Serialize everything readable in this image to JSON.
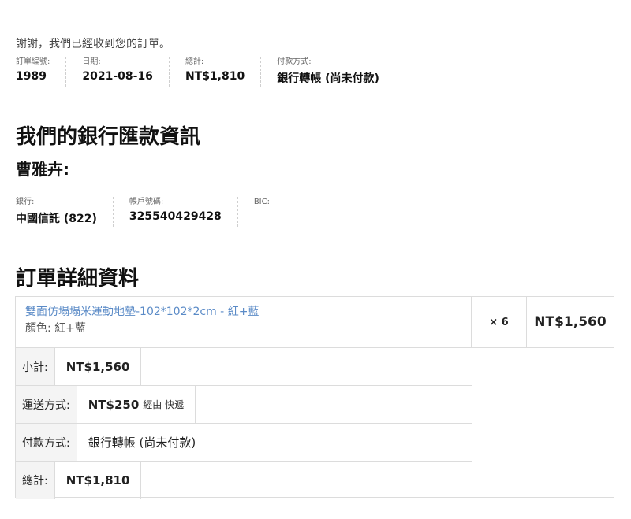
{
  "thanks": "謝謝，我們已經收到您的訂單。",
  "overview": [
    {
      "label": "訂單編號:",
      "value": "1989"
    },
    {
      "label": "日期:",
      "value": "2021-08-16"
    },
    {
      "label": "總計:",
      "value": "NT$1,810"
    },
    {
      "label": "付款方式:",
      "value": "銀行轉帳 (尚未付款)"
    }
  ],
  "bank_section": {
    "title": "我們的銀行匯款資訊",
    "account_name": "曹雅卉:",
    "details": [
      {
        "label": "銀行:",
        "value": "中國信託 (822)"
      },
      {
        "label": "帳戶號碼:",
        "value": "325540429428"
      },
      {
        "label": "BIC:",
        "value": ""
      }
    ]
  },
  "order_details": {
    "title": "訂單詳細資料",
    "product": {
      "name": "雙面仿塌塌米運動地墊-102*102*2cm - 紅+藍",
      "variation": "顏色: 紅+藍",
      "qty": "× 6",
      "total": "NT$1,560"
    },
    "totals": [
      {
        "label": "小計:",
        "value": "NT$1,560",
        "sub": ""
      },
      {
        "label": "運送方式:",
        "value": "NT$250",
        "sub": "經由 快遞"
      },
      {
        "label": "付款方式:",
        "value": "銀行轉帳 (尚未付款)",
        "sub": ""
      },
      {
        "label": "總計:",
        "value": "NT$1,810",
        "sub": ""
      }
    ]
  }
}
